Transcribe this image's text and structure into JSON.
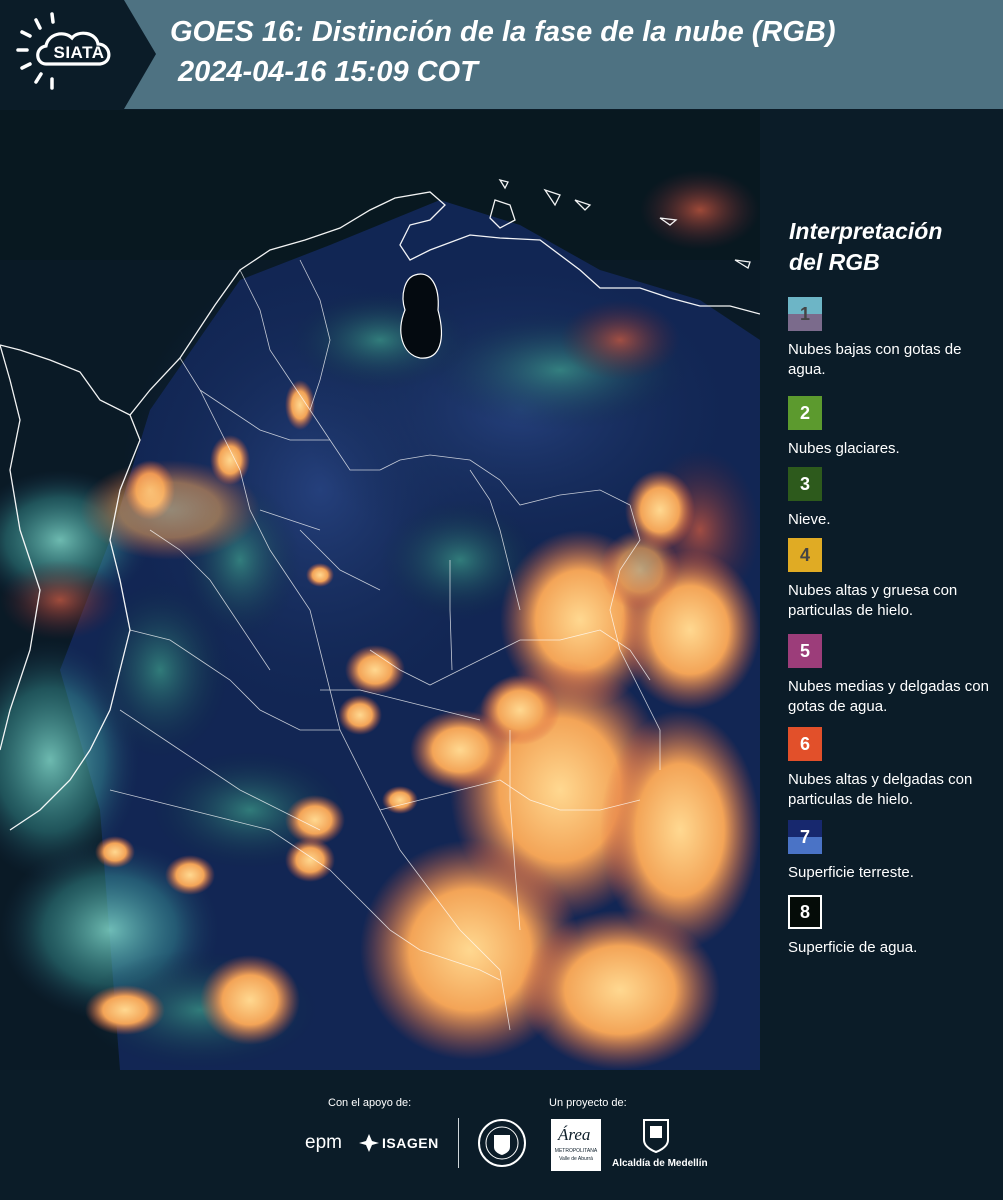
{
  "header": {
    "logo_text": "SIATA",
    "title_line1": "GOES 16: Distinción de la fase de la nube (RGB)",
    "title_line2": "2024-04-16 15:09 COT"
  },
  "legend": {
    "title_line1": "Interpretación",
    "title_line2": "del RGB",
    "items": [
      {
        "num": "1",
        "desc": "Nubes bajas con gotas de agua.",
        "color_top": "#6db5c6",
        "color_bottom": "#7b6b8c",
        "num_color": "#444444"
      },
      {
        "num": "2",
        "desc": "Nubes glaciares.",
        "color_top": "#5c9a2e",
        "color_bottom": "#5c9a2e",
        "num_color": "#ffffff"
      },
      {
        "num": "3",
        "desc": "Nieve.",
        "color_top": "#2d5a1c",
        "color_bottom": "#2d5a1c",
        "num_color": "#ffffff"
      },
      {
        "num": "4",
        "desc": "Nubes altas y gruesa con particulas de hielo.",
        "color_top": "#e0ab24",
        "color_bottom": "#e0ab24",
        "num_color": "#444444"
      },
      {
        "num": "5",
        "desc": "Nubes medias y delgadas con gotas de agua.",
        "color_top": "#9c3d7a",
        "color_bottom": "#9c3d7a",
        "num_color": "#ffffff"
      },
      {
        "num": "6",
        "desc": "Nubes altas y delgadas con particulas de hielo.",
        "color_top": "#e2502a",
        "color_bottom": "#e2502a",
        "num_color": "#ffffff"
      },
      {
        "num": "7",
        "desc": "Superficie terreste.",
        "color_top": "#17286e",
        "color_bottom": "#4a73c6",
        "num_color": "#ffffff"
      },
      {
        "num": "8",
        "desc": "Superficie de agua.",
        "color_top": "#050c08",
        "color_bottom": "#050c08",
        "num_color": "#ffffff"
      }
    ]
  },
  "footer": {
    "support_label": "Con el apoyo de:",
    "project_label": "Un proyecto de:",
    "epm": "epm",
    "isagen": "ISAGEN",
    "area_text": "Área",
    "area_sub": "METROPOLITANA",
    "area_sub2": "Valle de Aburrá",
    "alcaldia": "Alcaldía de Medellín"
  },
  "colors": {
    "header_bg": "#4e7282",
    "page_bg": "#0b1c28",
    "cloud_orange": "#f2a65a",
    "cloud_core": "#ffd38a",
    "land_blue": "#1a2e66",
    "low_cloud_cyan": "#5ec8c0"
  }
}
